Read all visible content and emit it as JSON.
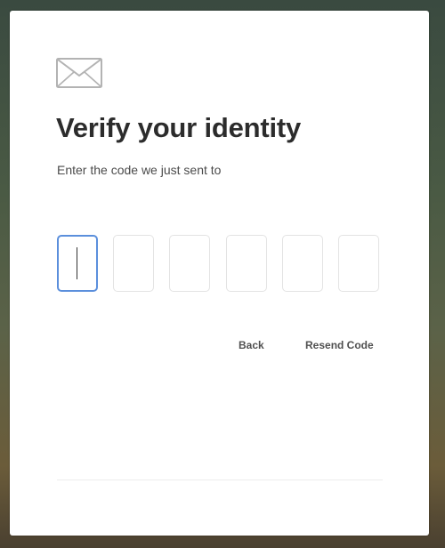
{
  "dialog": {
    "title": "Verify your identity",
    "subtitle": "Enter the code we just sent to",
    "code_inputs": [
      {
        "value": ""
      },
      {
        "value": ""
      },
      {
        "value": ""
      },
      {
        "value": ""
      },
      {
        "value": ""
      },
      {
        "value": ""
      }
    ],
    "back_label": "Back",
    "resend_label": "Resend Code",
    "icon": "envelope-icon"
  },
  "colors": {
    "focus_border": "#5b8fdc",
    "input_border": "#e3e3e3",
    "title_text": "#2c2c2c",
    "link_text": "#505050"
  }
}
